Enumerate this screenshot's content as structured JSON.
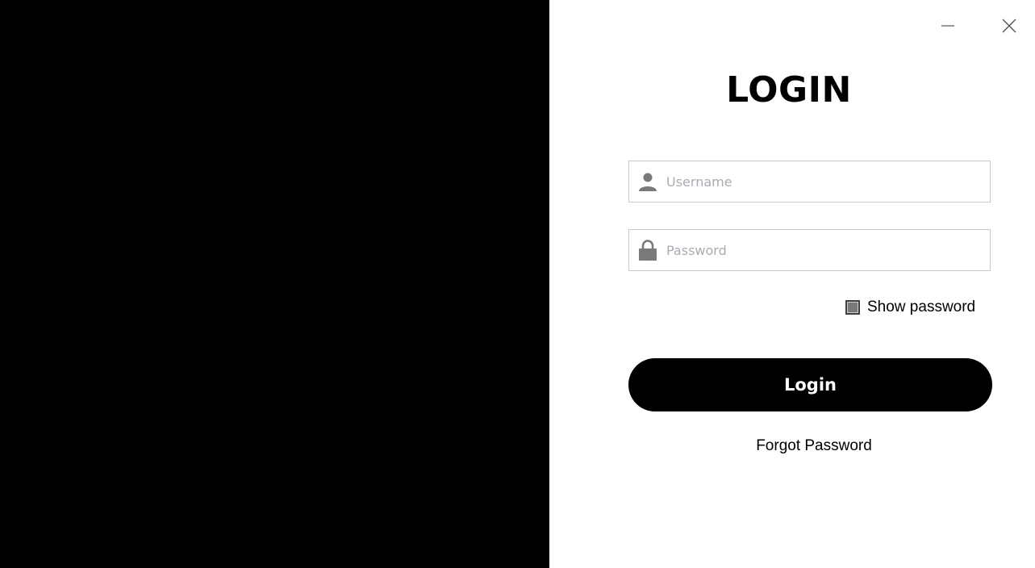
{
  "window": {
    "minimize_icon": "minimize-icon",
    "close_icon": "close-icon"
  },
  "form": {
    "title": "LOGIN",
    "username": {
      "icon": "user-icon",
      "value": "",
      "placeholder": "Username"
    },
    "password": {
      "icon": "lock-icon",
      "value": "",
      "placeholder": "Password"
    },
    "show_password": {
      "label": "Show password",
      "checked": false
    },
    "login_button": "Login",
    "forgot_link": "Forgot Password"
  },
  "colors": {
    "left_panel": "#000000",
    "background": "#ffffff",
    "button": "#000000",
    "button_text": "#ffffff",
    "placeholder": "#a9acb3",
    "icon": "#7a7a7a",
    "field_border": "#c9c9c9"
  }
}
